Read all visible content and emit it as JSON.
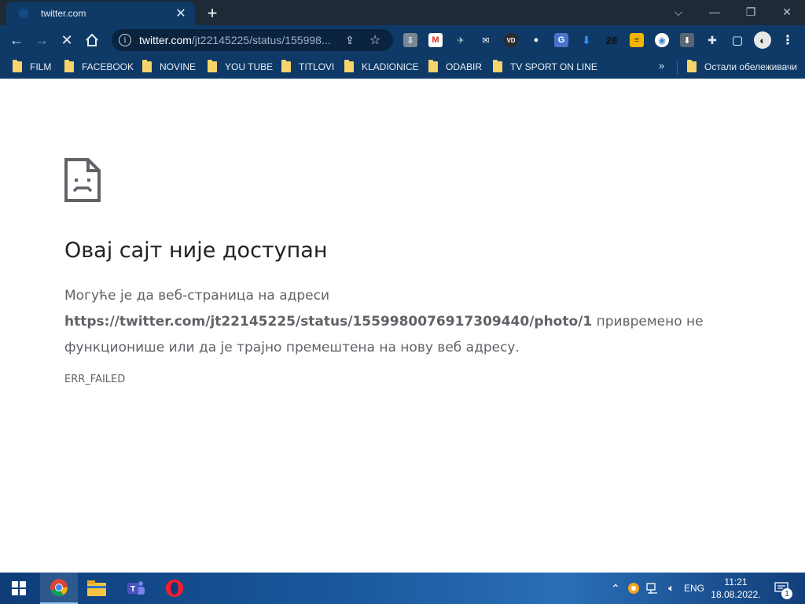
{
  "browser": {
    "tab": {
      "title": "twitter.com",
      "favicon": "twitter-favicon",
      "close_icon": "close-icon"
    },
    "newtab_icon": "plus-icon",
    "window_controls": [
      "chevron-down-icon",
      "minimize-icon",
      "restore-icon",
      "close-icon"
    ],
    "omnibox": {
      "host": "twitter.com",
      "path": "/jt22145225/status/155998...",
      "icons": [
        "info-icon",
        "share-icon",
        "star-icon"
      ]
    },
    "extensions": [
      {
        "name": "download-icon",
        "glyph": "⇩"
      },
      {
        "name": "gmail-icon",
        "glyph": "M"
      },
      {
        "name": "puzzle-ext-icon",
        "glyph": "✈"
      },
      {
        "name": "mail-icon",
        "glyph": "✉"
      },
      {
        "name": "vd-icon",
        "glyph": "VD"
      },
      {
        "name": "bubbles-icon",
        "glyph": "●"
      },
      {
        "name": "translate-icon",
        "glyph": "G"
      },
      {
        "name": "arrow-download-icon",
        "glyph": "⬇"
      },
      {
        "name": "counter-badge",
        "glyph": "28"
      },
      {
        "name": "notes-icon",
        "glyph": "≡"
      },
      {
        "name": "circle-ext-icon",
        "glyph": "◉"
      },
      {
        "name": "save-icon",
        "glyph": "⬇"
      },
      {
        "name": "extensions-icon",
        "glyph": "✚"
      },
      {
        "name": "sidepanel-icon",
        "glyph": "▢"
      },
      {
        "name": "profile-avatar",
        "glyph": "◐"
      },
      {
        "name": "menu-icon",
        "glyph": "⋮"
      }
    ]
  },
  "bookmarks": {
    "items": [
      "FILM",
      "FACEBOOK",
      "NOVINE",
      "YOU TUBE",
      "TITLOVI",
      "KLADIONICE",
      "ODABIR",
      "TV SPORT ON LINE"
    ],
    "more": "»",
    "other": "Остали обележивачи"
  },
  "error_page": {
    "title": "Овај сајт није доступан",
    "desc_prefix": "Могуће је да веб-страница на адреси",
    "url": "https://twitter.com/jt22145225/status/1559980076917309440/photo/1",
    "desc_suffix": "привремено не функционише или да је трајно премештена на нову веб адресу.",
    "code": "ERR_FAILED"
  },
  "taskbar": {
    "apps": [
      "windows-start-icon",
      "chrome-icon",
      "file-explorer-icon",
      "teams-icon",
      "opera-icon"
    ],
    "tray": {
      "chevron": "⌃",
      "lang": "ENG",
      "time": "11:21",
      "date": "18.08.2022.",
      "notification_count": "1"
    }
  },
  "colors": {
    "tab_bg": "#0f3a67",
    "titlebar_bg": "#1f2a37",
    "error_text": "#5f6368"
  }
}
